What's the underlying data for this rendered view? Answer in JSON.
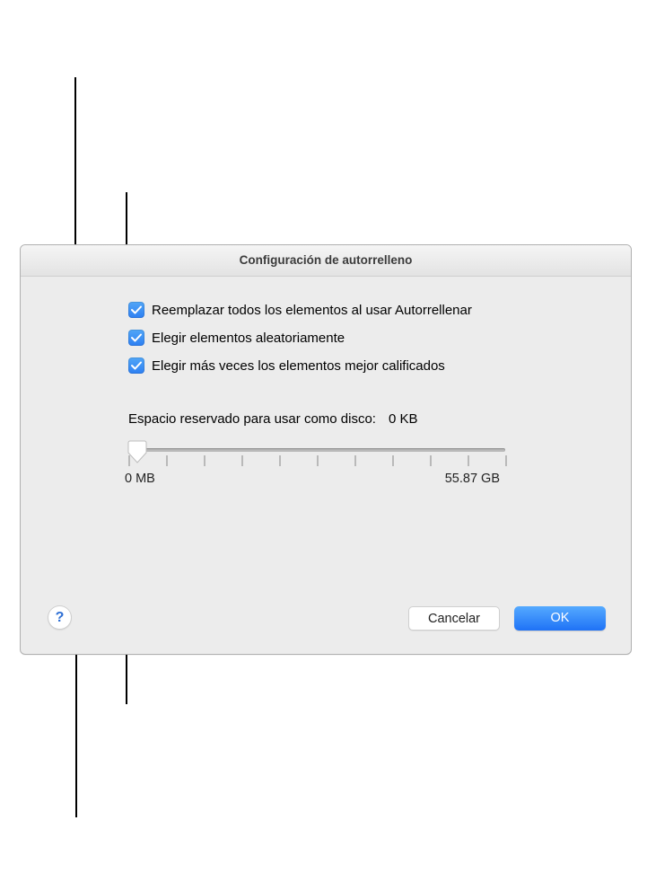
{
  "title": "Configuración de autorrelleno",
  "checkboxes": {
    "replace": {
      "label": "Reemplazar todos los elementos al usar Autorrellenar",
      "checked": true
    },
    "random": {
      "label": "Elegir elementos aleatoriamente",
      "checked": true
    },
    "rated": {
      "label": "Elegir más veces los elementos mejor calificados",
      "checked": true
    }
  },
  "disk": {
    "label": "Espacio reservado para usar como disco:",
    "value": "0 KB",
    "min_label": "0 MB",
    "max_label": "55.87 GB"
  },
  "buttons": {
    "cancel": "Cancelar",
    "ok": "OK",
    "help": "?"
  }
}
